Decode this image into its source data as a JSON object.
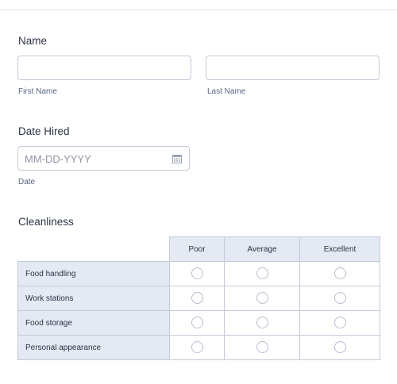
{
  "name_section": {
    "label": "Name",
    "first": {
      "value": "",
      "sublabel": "First Name"
    },
    "last": {
      "value": "",
      "sublabel": "Last Name"
    }
  },
  "date_section": {
    "label": "Date Hired",
    "placeholder": "MM-DD-YYYY",
    "sublabel": "Date",
    "icon": "calendar-icon"
  },
  "matrix": {
    "label": "Cleanliness",
    "columns": [
      "Poor",
      "Average",
      "Excellent"
    ],
    "rows": [
      "Food handling",
      "Work stations",
      "Food storage",
      "Personal appearance"
    ]
  }
}
